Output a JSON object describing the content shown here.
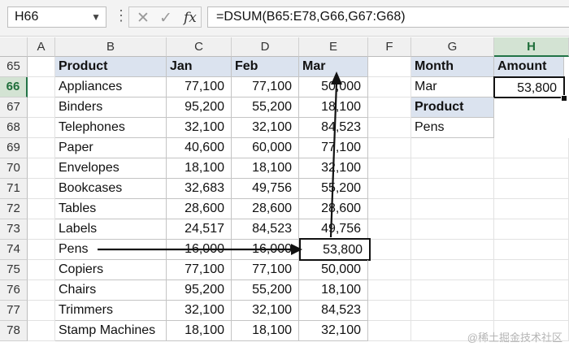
{
  "formula_bar": {
    "name_box": "H66",
    "cancel_icon": "✕",
    "enter_icon": "✓",
    "fx_icon": "fx",
    "formula": "=DSUM(B65:E78,G66,G67:G68)"
  },
  "columns": [
    "A",
    "B",
    "C",
    "D",
    "E",
    "F",
    "G",
    "H"
  ],
  "rows": [
    "65",
    "66",
    "67",
    "68",
    "69",
    "70",
    "71",
    "72",
    "73",
    "74",
    "75",
    "76",
    "77",
    "78"
  ],
  "table": {
    "headers": [
      "Product",
      "Jan",
      "Feb",
      "Mar"
    ],
    "rows": [
      [
        "Appliances",
        "77,100",
        "77,100",
        "50,000"
      ],
      [
        "Binders",
        "95,200",
        "55,200",
        "18,100"
      ],
      [
        "Telephones",
        "32,100",
        "32,100",
        "84,523"
      ],
      [
        "Paper",
        "40,600",
        "60,000",
        "77,100"
      ],
      [
        "Envelopes",
        "18,100",
        "18,100",
        "32,100"
      ],
      [
        "Bookcases",
        "32,683",
        "49,756",
        "55,200"
      ],
      [
        "Tables",
        "28,600",
        "28,600",
        "28,600"
      ],
      [
        "Labels",
        "24,517",
        "84,523",
        "49,756"
      ],
      [
        "Pens",
        "16,000",
        "16,000",
        "53,800"
      ],
      [
        "Copiers",
        "77,100",
        "77,100",
        "50,000"
      ],
      [
        "Chairs",
        "95,200",
        "55,200",
        "18,100"
      ],
      [
        "Trimmers",
        "32,100",
        "32,100",
        "84,523"
      ],
      [
        "Stamp Machines",
        "18,100",
        "18,100",
        "32,100"
      ]
    ]
  },
  "criteria": {
    "month_label": "Month",
    "amount_label": "Amount",
    "month_value": "Mar",
    "amount_value": "53,800",
    "product_label": "Product",
    "product_value": "Pens"
  },
  "watermark": "@稀土掘金技术社区",
  "colors": {
    "header_fill": "#dbe3ef",
    "selected_header": "#d3e3d3",
    "excel_green": "#217346"
  }
}
